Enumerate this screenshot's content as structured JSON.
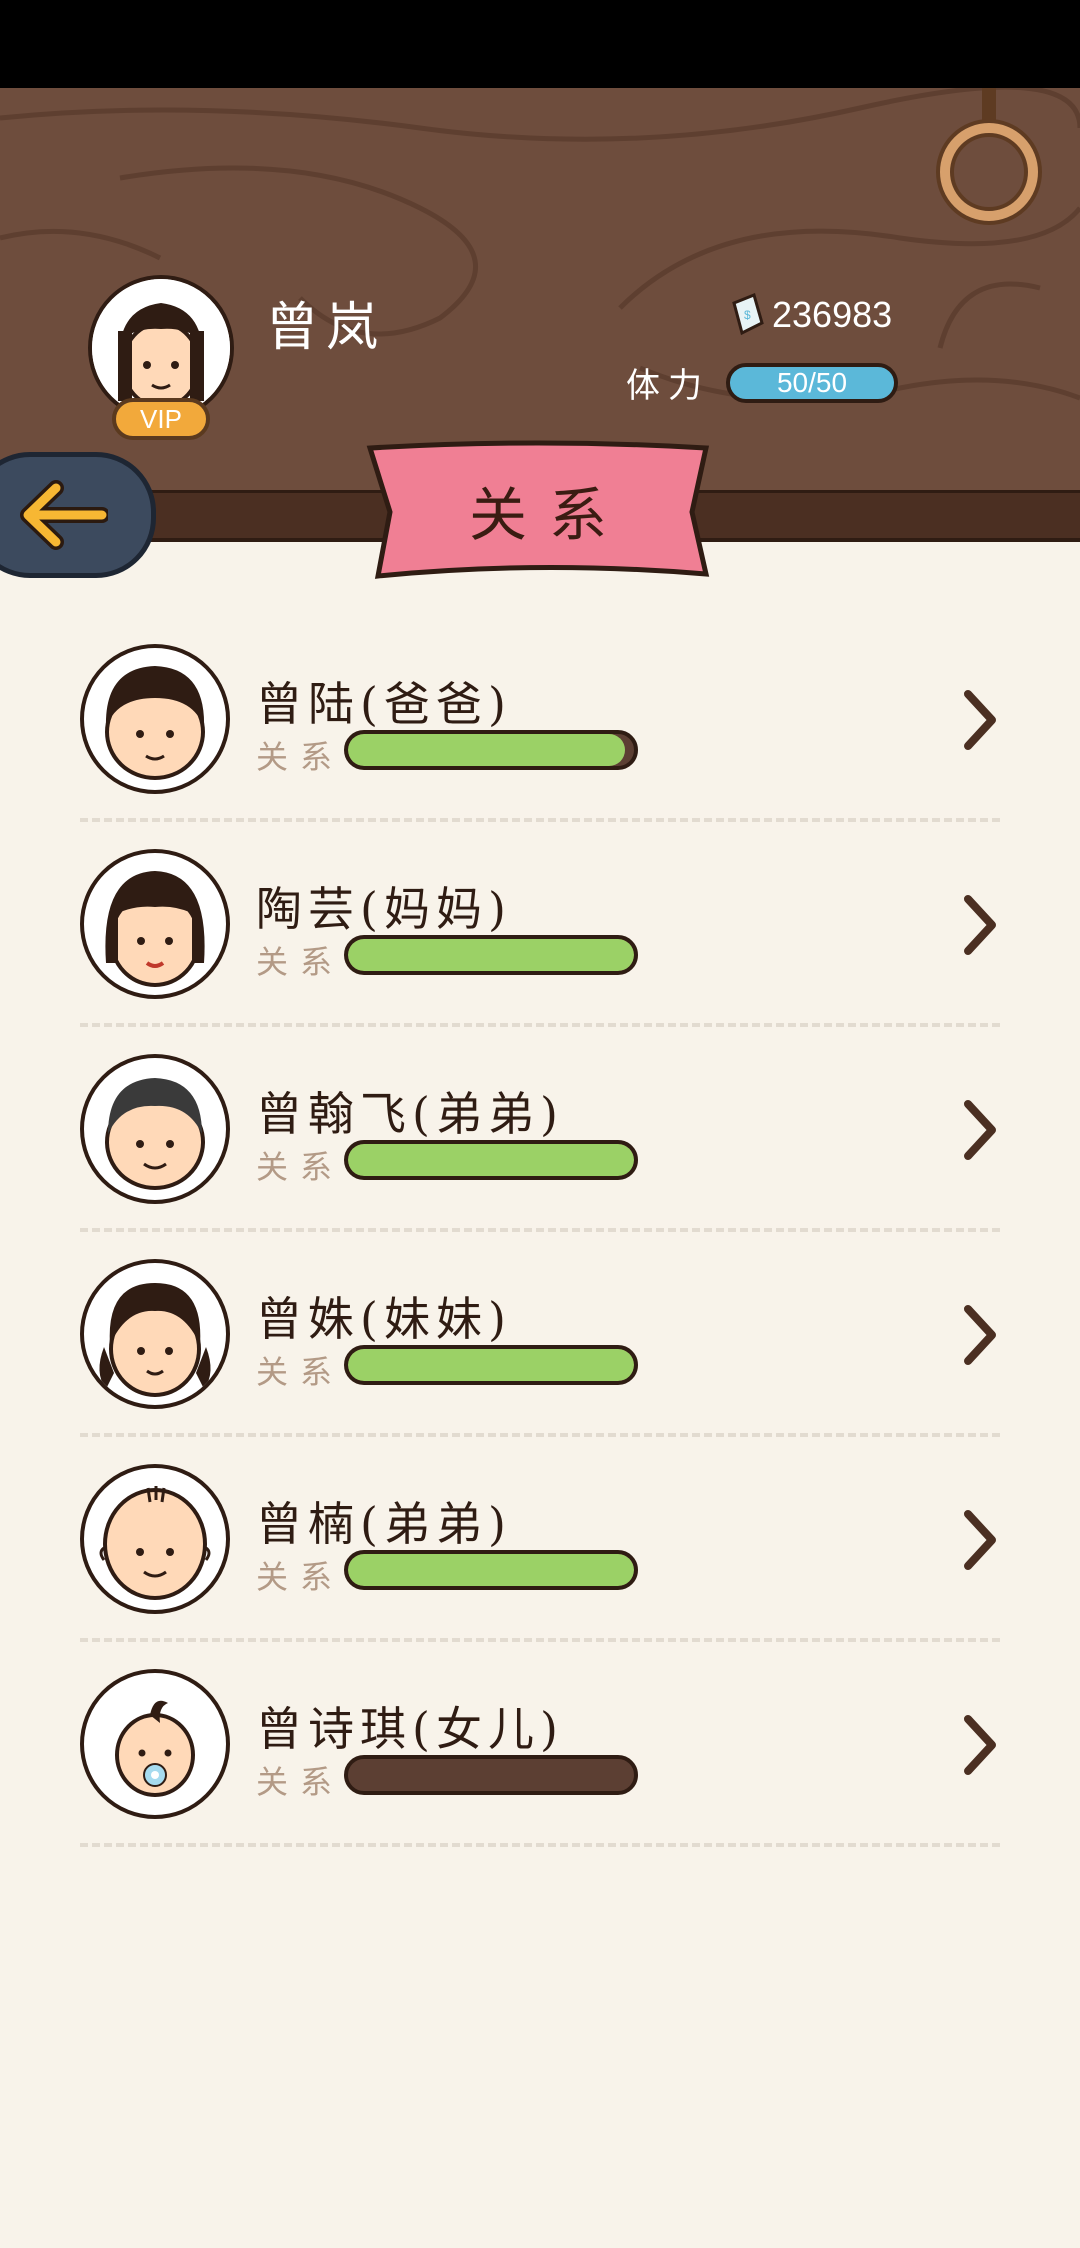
{
  "header": {
    "player_name": "曾岚",
    "vip_label": "VIP",
    "money": "236983",
    "stamina_label": "体力",
    "stamina_value": "50/50",
    "page_title": "关系"
  },
  "relations": [
    {
      "name": "曾陆(爸爸)",
      "relation_label": "关系",
      "relation_level": 0.97
    },
    {
      "name": "陶芸(妈妈)",
      "relation_label": "关系",
      "relation_level": 1.0
    },
    {
      "name": "曾翰飞(弟弟)",
      "relation_label": "关系",
      "relation_level": 1.0
    },
    {
      "name": "曾姝(妹妹)",
      "relation_label": "关系",
      "relation_level": 1.0
    },
    {
      "name": "曾楠(弟弟)",
      "relation_label": "关系",
      "relation_level": 1.0
    },
    {
      "name": "曾诗琪(女儿)",
      "relation_label": "关系",
      "relation_level": 0.0
    }
  ],
  "colors": {
    "header_wood": "#6e4d3d",
    "banner_pink": "#f07f94",
    "bar_green": "#9bd166",
    "stamina_blue": "#5bb8d9",
    "back_button": "#3c4a5e",
    "arrow_yellow": "#f7b733"
  },
  "icons": {
    "back": "arrow-left-icon",
    "money": "banknote-icon",
    "ring": "hanging-ring-icon",
    "chevron": "chevron-right-icon"
  }
}
